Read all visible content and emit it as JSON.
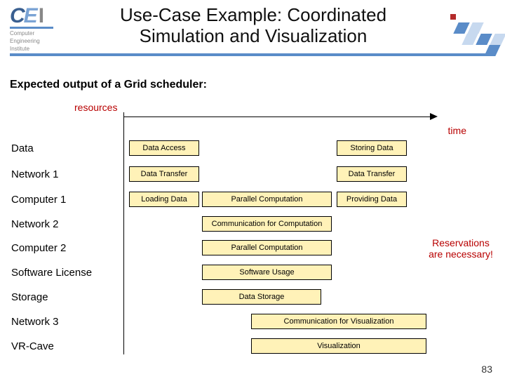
{
  "header": {
    "logo_letters": {
      "c": "C",
      "e": "E",
      "i": "I"
    },
    "logo_sub1": "Computer",
    "logo_sub2": "Engineering",
    "logo_sub3": "Institute",
    "title": "Use-Case Example: Coordinated Simulation and Visualization"
  },
  "subtitle": "Expected output of a Grid scheduler:",
  "axes": {
    "resources": "resources",
    "time": "time"
  },
  "rows": {
    "data": "Data",
    "net1": "Network 1",
    "comp1": "Computer 1",
    "net2": "Network 2",
    "comp2": "Computer 2",
    "sw": "Software License",
    "storage": "Storage",
    "net3": "Network 3",
    "vr": "VR-Cave"
  },
  "boxes": {
    "data_access": "Data Access",
    "storing_data": "Storing Data",
    "data_transfer_a": "Data Transfer",
    "data_transfer_b": "Data Transfer",
    "loading_data": "Loading Data",
    "parallel_comp_1": "Parallel Computation",
    "providing_data": "Providing Data",
    "comm_comp": "Communication for Computation",
    "parallel_comp_2": "Parallel Computation",
    "sw_usage": "Software Usage",
    "data_storage": "Data Storage",
    "comm_vis": "Communication for Visualization",
    "visualization": "Visualization"
  },
  "callout": "Reservations are necessary!",
  "pagenum": "83",
  "chart_data": {
    "type": "table",
    "title": "Expected output of a Grid scheduler",
    "x_axis": "time (relative units 0–5)",
    "y_axis": "resources",
    "rows": [
      {
        "resource": "Data",
        "tasks": [
          {
            "label": "Data Access",
            "start": 0,
            "end": 1
          },
          {
            "label": "Storing Data",
            "start": 3.5,
            "end": 4.5
          }
        ]
      },
      {
        "resource": "Network 1",
        "tasks": [
          {
            "label": "Data Transfer",
            "start": 0,
            "end": 1
          },
          {
            "label": "Data Transfer",
            "start": 3.5,
            "end": 4.5
          }
        ]
      },
      {
        "resource": "Computer 1",
        "tasks": [
          {
            "label": "Loading Data",
            "start": 0,
            "end": 1
          },
          {
            "label": "Parallel Computation",
            "start": 1,
            "end": 3.3
          },
          {
            "label": "Providing Data",
            "start": 3.5,
            "end": 4.5
          }
        ]
      },
      {
        "resource": "Network 2",
        "tasks": [
          {
            "label": "Communication for Computation",
            "start": 1,
            "end": 3.3
          }
        ]
      },
      {
        "resource": "Computer 2",
        "tasks": [
          {
            "label": "Parallel Computation",
            "start": 1,
            "end": 3.3
          }
        ]
      },
      {
        "resource": "Software License",
        "tasks": [
          {
            "label": "Software Usage",
            "start": 1,
            "end": 3.3
          }
        ]
      },
      {
        "resource": "Storage",
        "tasks": [
          {
            "label": "Data Storage",
            "start": 1,
            "end": 3.1
          }
        ]
      },
      {
        "resource": "Network 3",
        "tasks": [
          {
            "label": "Communication for Visualization",
            "start": 1.8,
            "end": 5
          }
        ]
      },
      {
        "resource": "VR-Cave",
        "tasks": [
          {
            "label": "Visualization",
            "start": 1.8,
            "end": 5
          }
        ]
      }
    ]
  }
}
